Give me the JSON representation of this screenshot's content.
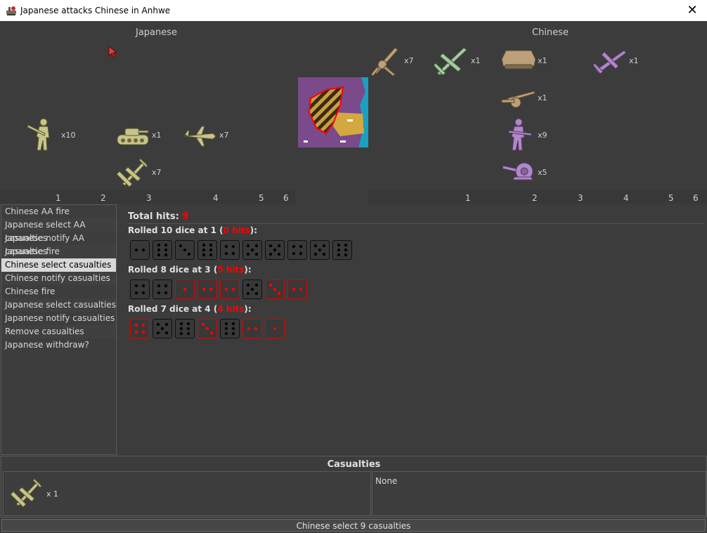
{
  "window": {
    "title": "Japanese attacks Chinese in Anhwe",
    "close_glyph": "✕"
  },
  "sides": {
    "attacker": "Japanese",
    "defender": "Chinese"
  },
  "attacker_units": [
    {
      "name": "infantry",
      "count": "x10"
    },
    {
      "name": "tank",
      "count": "x1"
    },
    {
      "name": "fighter",
      "count": "x7"
    },
    {
      "name": "bomber",
      "count": "x7"
    }
  ],
  "defender_units": [
    {
      "name": "artillery",
      "count": "x7"
    },
    {
      "name": "fighter",
      "count": "x1"
    },
    {
      "name": "armored-car",
      "count": "x1"
    },
    {
      "name": "ally-fighter",
      "count": "x1"
    },
    {
      "name": "field-gun",
      "count": "x1"
    },
    {
      "name": "ally-infantry",
      "count": "x9"
    },
    {
      "name": "ally-artillery",
      "count": "x5"
    }
  ],
  "dice_numbers": [
    "1",
    "2",
    "3",
    "4",
    "5",
    "6"
  ],
  "steps": [
    "Chinese AA fire",
    "Japanese select AA casualties",
    "Japanese notify AA casualties",
    "Japanese fire",
    "Chinese select casualties",
    "Chinese notify casualties",
    "Chinese fire",
    "Japanese select casualties",
    "Japanese notify casualties",
    "Remove casualties",
    "Japanese withdraw?"
  ],
  "selected_step": 4,
  "results": {
    "total_label": "Total hits:",
    "total_value": "9",
    "rolls": [
      {
        "prefix": "Rolled 10 dice at 1 (",
        "hits": "0 hits",
        "suffix": "):",
        "dice": [
          2,
          6,
          3,
          6,
          4,
          5,
          5,
          4,
          5,
          6
        ],
        "hit": [
          false,
          false,
          false,
          false,
          false,
          false,
          false,
          false,
          false,
          false
        ]
      },
      {
        "prefix": "Rolled 8 dice at 3 (",
        "hits": "5 hits",
        "suffix": "):",
        "dice": [
          4,
          4,
          1,
          2,
          2,
          5,
          3,
          2
        ],
        "hit": [
          false,
          false,
          true,
          true,
          true,
          false,
          true,
          true
        ]
      },
      {
        "prefix": "Rolled 7 dice at 4 (",
        "hits": "4 hits",
        "suffix": "):",
        "dice": [
          4,
          5,
          6,
          3,
          6,
          2,
          1
        ],
        "hit": [
          true,
          false,
          false,
          true,
          false,
          true,
          true
        ]
      }
    ]
  },
  "casualties": {
    "title": "Casualties",
    "attacker_count": "x 1",
    "defender_text": "None"
  },
  "action_button": "Chinese select 9 casualties",
  "colors": {
    "hit": "#ff0000",
    "japan_unit": "#c9c48a",
    "china_unit": "#bba07a",
    "ally_unit": "#b088c8"
  }
}
